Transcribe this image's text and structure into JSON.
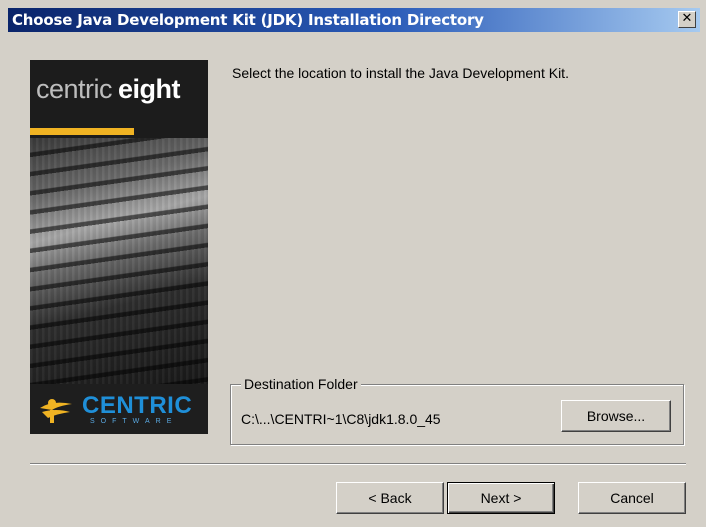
{
  "window": {
    "title": "Choose Java Development Kit (JDK) Installation Directory",
    "close_glyph": "✕"
  },
  "sidebar": {
    "logo_word1": "centric",
    "logo_word2": "eight",
    "brand_name": "CENTRIC",
    "brand_sub": "SOFTWARE",
    "accent_color": "#f0b323",
    "brand_color": "#1f8fd8"
  },
  "content": {
    "instruction": "Select the location to install the Java Development Kit."
  },
  "destination": {
    "legend": "Destination Folder",
    "path": "C:\\...\\CENTRI~1\\C8\\jdk1.8.0_45",
    "browse_label": "Browse..."
  },
  "buttons": {
    "back": "< Back",
    "next": "Next >",
    "cancel": "Cancel"
  }
}
